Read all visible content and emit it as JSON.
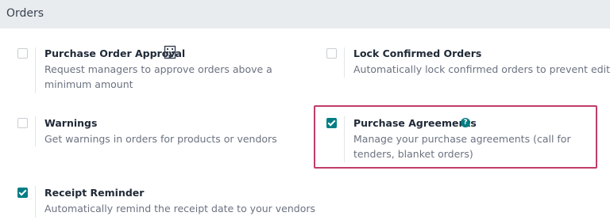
{
  "section": {
    "title": "Orders"
  },
  "settings": {
    "po_approval": {
      "label": "Purchase Order Approval",
      "desc": "Request managers to approve orders above a minimum amount",
      "checked": false,
      "icon": "building-icon"
    },
    "lock_orders": {
      "label": "Lock Confirmed Orders",
      "desc": "Automatically lock confirmed orders to prevent editing",
      "checked": false
    },
    "warnings": {
      "label": "Warnings",
      "desc": "Get warnings in orders for products or vendors",
      "checked": false
    },
    "purchase_agreements": {
      "label": "Purchase Agreements",
      "desc": "Manage your purchase agreements (call for tenders, blanket orders)",
      "checked": true,
      "icon": "help-icon",
      "icon_text": "?"
    },
    "receipt_reminder": {
      "label": "Receipt Reminder",
      "desc": "Automatically remind the receipt date to your vendors",
      "checked": true
    }
  },
  "colors": {
    "accent": "#017e84",
    "highlight": "#c03c6a",
    "header_bg": "#e9ecef"
  }
}
